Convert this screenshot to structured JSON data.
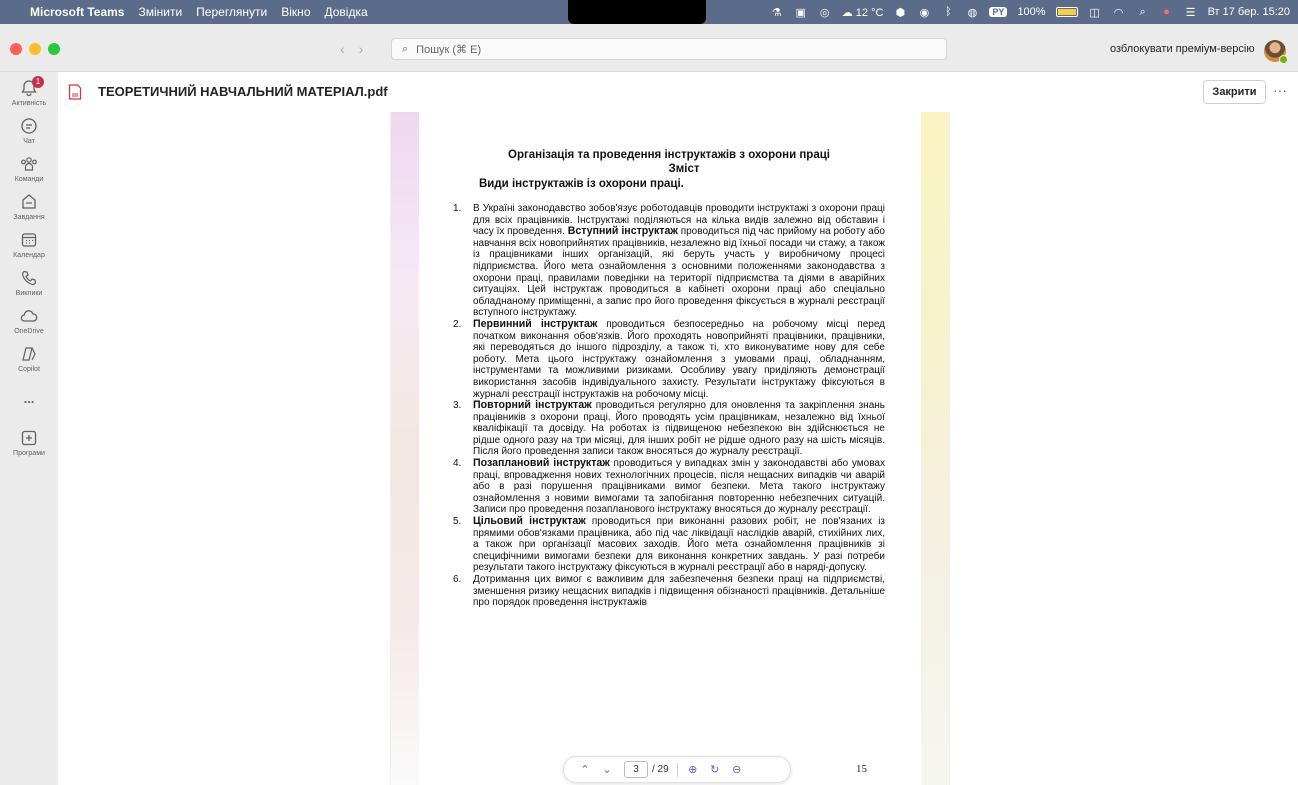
{
  "menubar": {
    "app_name": "Microsoft Teams",
    "menus": [
      "Змінити",
      "Переглянути",
      "Вікно",
      "Довідка"
    ],
    "weather": "12 °C",
    "battery": "100%",
    "keyboard_layout": "PY",
    "datetime": "Вт 17 бер. 15:20"
  },
  "titlebar": {
    "search_placeholder": "Пошук (⌘ E)",
    "premium_label": "озблокувати преміум-версію"
  },
  "rail": {
    "badge_count": "1",
    "items": [
      {
        "label": "Активність",
        "icon": "bell-icon"
      },
      {
        "label": "Чат",
        "icon": "chat-icon"
      },
      {
        "label": "Команди",
        "icon": "teams-icon"
      },
      {
        "label": "Завдання",
        "icon": "assignments-icon"
      },
      {
        "label": "Календар",
        "icon": "calendar-icon"
      },
      {
        "label": "Виклики",
        "icon": "phone-icon"
      },
      {
        "label": "OneDrive",
        "icon": "cloud-icon"
      },
      {
        "label": "Copilot",
        "icon": "copilot-icon"
      },
      {
        "label": "...",
        "icon": "more-icon"
      },
      {
        "label": "Програми",
        "icon": "add-apps-icon"
      }
    ]
  },
  "file": {
    "title": "ТЕОРЕТИЧНИЙ НАВЧАЛЬНИЙ МАТЕРІАЛ.pdf",
    "close_label": "Закрити",
    "more_label": "···"
  },
  "document": {
    "heading": "Організація та проведення інструктажів з охорони праці",
    "subtitle": "Зміст",
    "section": "Види інструктажів із охорони праці.",
    "items": [
      {
        "num": "1.",
        "pre": "В Україні законодавство зобов'язує роботодавців проводити інструктажі з охорони праці для всіх працівників. Інструктажі поділяються на кілька видів залежно від обставин і часу їх проведення. ",
        "bold": "Вступний інструктаж",
        "post": " проводиться під час прийому на роботу або навчання всіх новоприйнятих працівників, незалежно від їхньої посади чи стажу, а також із працівниками інших організацій, які беруть участь у виробничому процесі підприємства. Його мета ознайомлення з основними положеннями законодавства з охорони праці, правилами поведінки на території підприємства та діями в аварійних ситуаціях. Цей інструктаж проводиться в кабінеті охорони праці або спеціально обладнаному приміщенні, а запис про його проведення фіксується в журналі реєстрації вступного інструктажу."
      },
      {
        "num": "2.",
        "pre": "",
        "bold": "Первинний інструктаж",
        "post": " проводиться безпосередньо на робочому місці перед початком виконання обов'язків. Його проходять новоприйняті працівники, працівники, які переводяться до іншого підрозділу, а також ті, хто виконуватиме нову для себе роботу. Мета цього інструктажу ознайомлення з умовами праці, обладнанням, інструментами та можливими ризиками. Особливу увагу приділяють демонстрації використання засобів індивідуального захисту. Результати інструктажу фіксуються в журналі реєстрації інструктажів на робочому місці."
      },
      {
        "num": "3.",
        "pre": "",
        "bold": "Повторний інструктаж",
        "post": " проводиться регулярно для оновлення та закріплення знань працівників з охорони праці. Його проводять усім працівникам, незалежно від їхньої кваліфікації та досвіду. На роботах із підвищеною небезпекою він здійснюється не рідше одного разу на три місяці, для інших робіт не рідше одного разу на шість місяців. Після його проведення записи також вносяться до журналу реєстрації."
      },
      {
        "num": "4.",
        "pre": "",
        "bold": "Позаплановий інструктаж",
        "post": " проводиться у випадках змін у законодавстві або умовах праці, впровадження нових технологічних процесів, після нещасних випадків чи аварій або в разі порушення працівниками вимог безпеки. Мета такого інструктажу ознайомлення з новими вимогами та запобігання повторенню небезпечних ситуацій. Записи про проведення позапланового інструктажу вносяться до журналу реєстрації."
      },
      {
        "num": "5.",
        "pre": "",
        "bold": "Цільовий інструктаж",
        "post": " проводиться при виконанні разових робіт, не пов'язаних із прямими обов'язками працівника, або під час ліквідації наслідків аварій, стихійних лих, а також при організації масових заходів. Його мета ознайомлення працівників зі специфічними вимогами безпеки для виконання конкретних завдань. У разі потреби результати такого інструктажу фіксуються в журналі реєстрації або в наряді-допуску."
      },
      {
        "num": "6.",
        "pre": "Дотримання цих вимог є важливим для забезпечення безпеки праці на підприємстві, зменшення ризику нещасних випадків і підвищення обізнаності працівників. Детальніше про порядок проведення інструктажів",
        "bold": "",
        "post": ""
      }
    ],
    "page_number": "15"
  },
  "pager": {
    "current_page": "3",
    "total": "/ 29"
  },
  "colors": {
    "accent": "#5b5fc7",
    "badge": "#c4314b",
    "menubar": "#5b6b8a"
  }
}
